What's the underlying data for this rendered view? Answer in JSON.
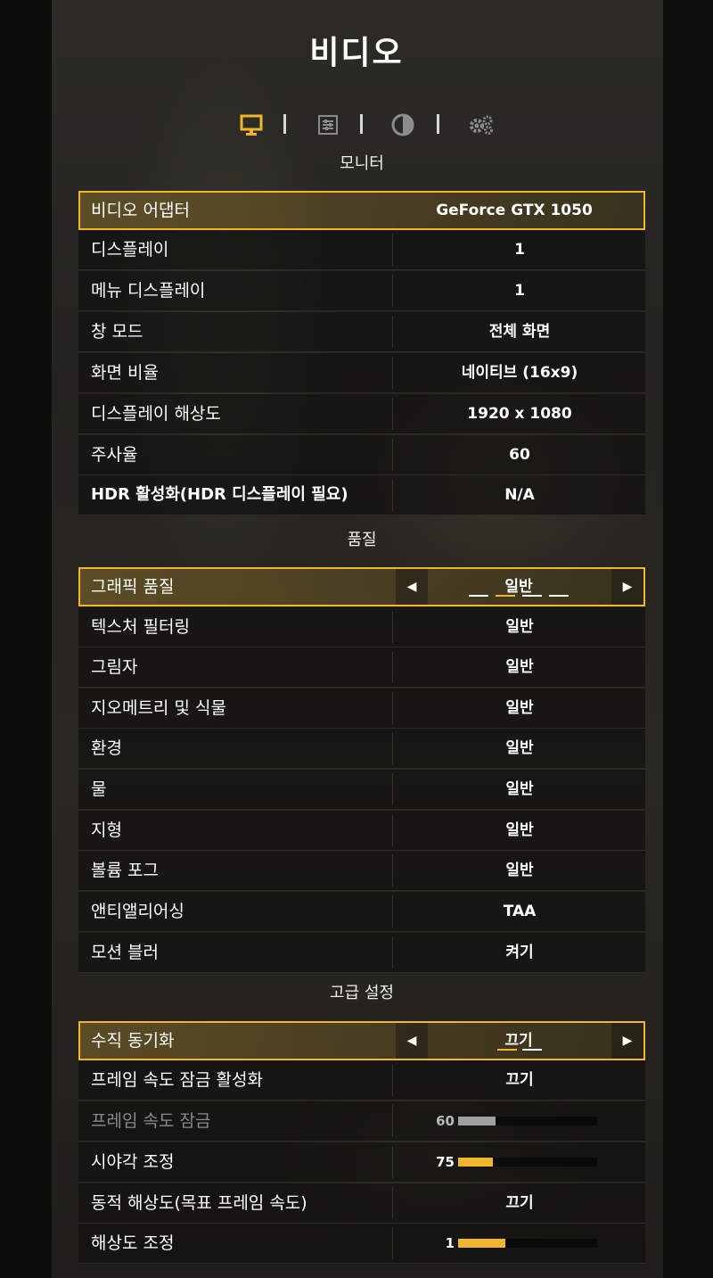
{
  "page": {
    "title": "비디오"
  },
  "tabs": [
    {
      "icon": "monitor-icon",
      "active": true
    },
    {
      "icon": "sliders-icon",
      "active": false
    },
    {
      "icon": "contrast-icon",
      "active": false
    },
    {
      "icon": "gears-icon",
      "active": false
    }
  ],
  "colors": {
    "accent": "#f2b62e",
    "slider_disabled": "#a0a0a0"
  },
  "sections": {
    "monitor": {
      "header": "모니터",
      "rows": [
        {
          "label": "비디오 어댑터",
          "value": "GeForce GTX 1050"
        },
        {
          "label": "디스플레이",
          "value": "1"
        },
        {
          "label": "메뉴 디스플레이",
          "value": "1"
        },
        {
          "label": "창 모드",
          "value": "전체 화면"
        },
        {
          "label": "화면 비율",
          "value": "네이티브 (16x9)"
        },
        {
          "label": "디스플레이 해상도",
          "value": "1920 x 1080"
        },
        {
          "label": "주사율",
          "value": "60"
        },
        {
          "label": "HDR 활성화(HDR 디스플레이 필요)",
          "value": "N/A"
        }
      ]
    },
    "quality": {
      "header": "품질",
      "rows": [
        {
          "label": "그래픽 품질",
          "value": "일반"
        },
        {
          "label": "텍스처 필터링",
          "value": "일반"
        },
        {
          "label": "그림자",
          "value": "일반"
        },
        {
          "label": "지오메트리 및 식물",
          "value": "일반"
        },
        {
          "label": "환경",
          "value": "일반"
        },
        {
          "label": "물",
          "value": "일반"
        },
        {
          "label": "지형",
          "value": "일반"
        },
        {
          "label": "볼륨 포그",
          "value": "일반"
        },
        {
          "label": "앤티앨리어싱",
          "value": "TAA"
        },
        {
          "label": "모션 블러",
          "value": "켜기"
        }
      ]
    },
    "advanced": {
      "header": "고급 설정",
      "rows": [
        {
          "label": "수직 동기화",
          "value": "끄기"
        },
        {
          "label": "프레임 속도 잠금 활성화",
          "value": "끄기"
        },
        {
          "label": "프레임 속도 잠금",
          "value": "60",
          "level_fraction": 0.27,
          "disabled": true
        },
        {
          "label": "시야각 조정",
          "value": "75",
          "level_fraction": 0.25
        },
        {
          "label": "동적 해상도(목표 프레임 속도)",
          "value": "끄기"
        },
        {
          "label": "해상도 조정",
          "value": "1",
          "level_fraction": 0.34
        }
      ]
    }
  }
}
